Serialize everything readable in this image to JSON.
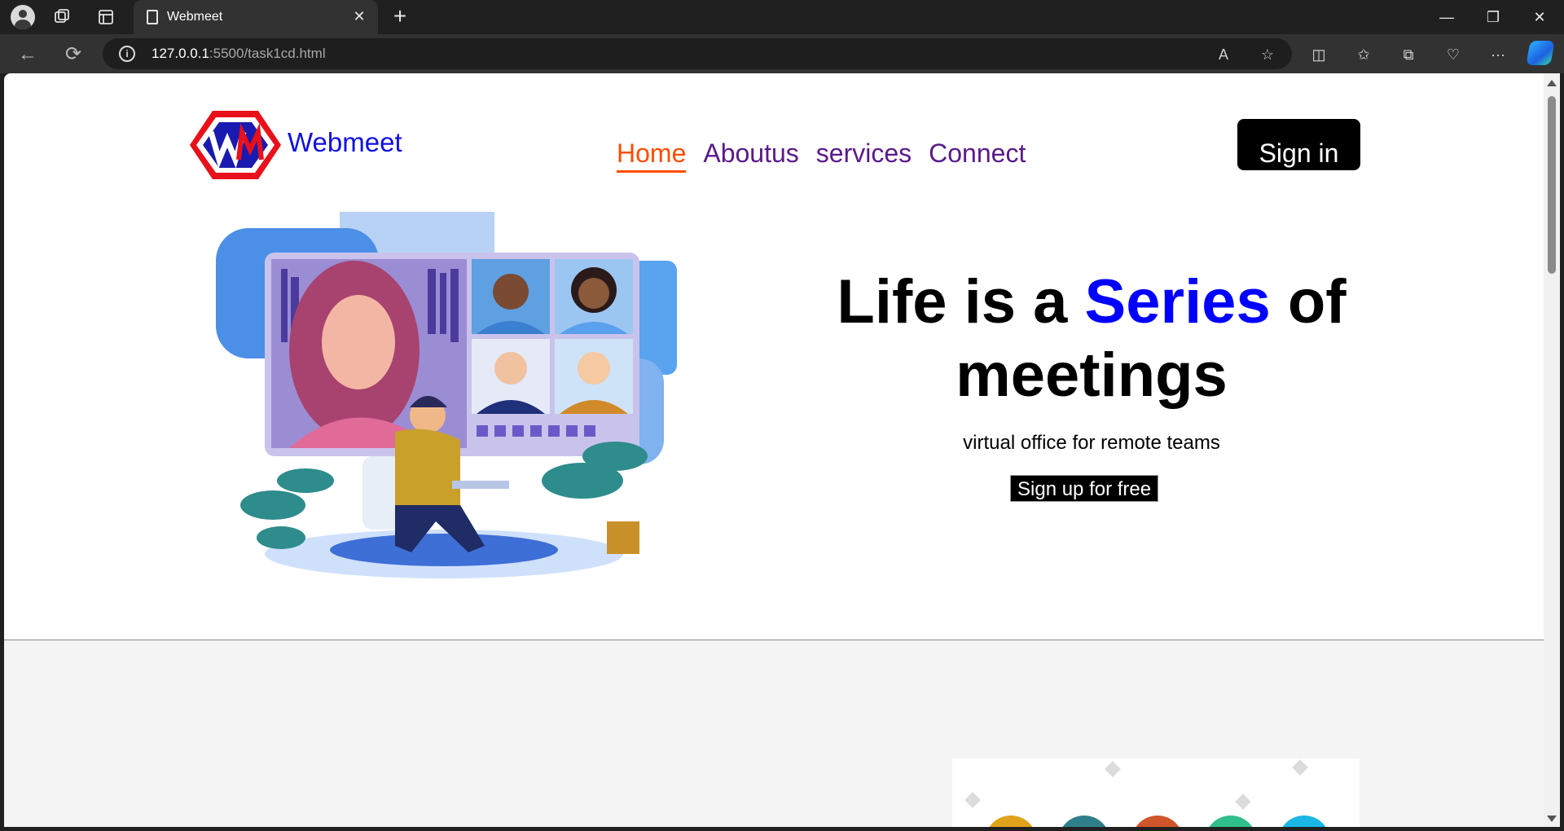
{
  "browser": {
    "tab_title": "Webmeet",
    "url_host": "127.0.0.1",
    "url_rest": ":5500/task1cd.html",
    "new_tab_symbol": "+",
    "close_tab_symbol": "✕"
  },
  "site": {
    "brand": "Webmeet",
    "logo_letters": "WM",
    "nav": [
      {
        "label": "Home",
        "active": true
      },
      {
        "label": "Aboutus",
        "active": false
      },
      {
        "label": "services",
        "active": false
      },
      {
        "label": "Connect",
        "active": false
      }
    ],
    "signin_label": "Sign in"
  },
  "hero": {
    "title_part1": "Life is a ",
    "title_highlight": "Series",
    "title_part2": " of meetings",
    "subtitle": "virtual office for remote teams",
    "cta_label": "Sign up for free"
  },
  "colors": {
    "brand_blue": "#1010e0",
    "nav_purple": "#5a1a8a",
    "nav_active": "#ff4d00",
    "highlight": "#0000ff"
  }
}
